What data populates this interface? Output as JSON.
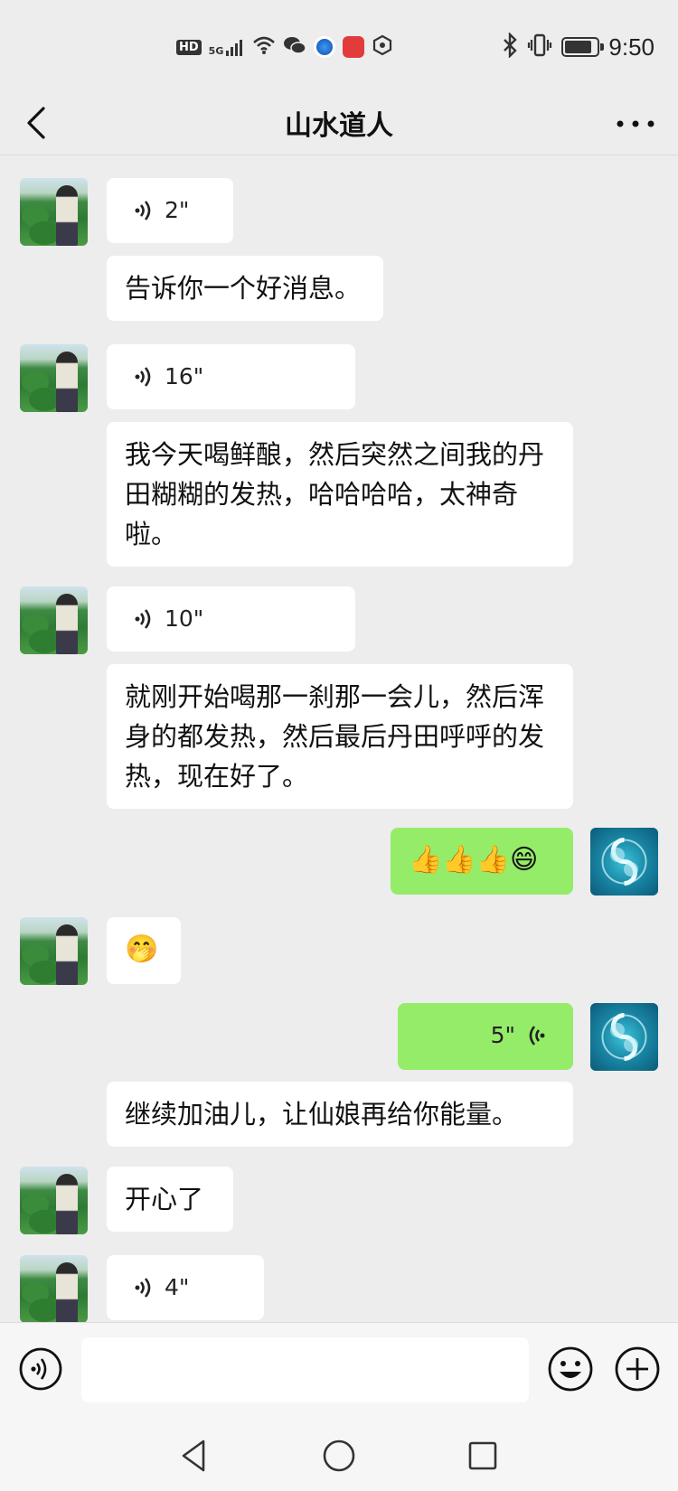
{
  "status_bar": {
    "network_badge": "HD",
    "network_type": "5G",
    "time": "9:50",
    "battery_level": 0.85,
    "icons": [
      "hd-icon",
      "signal-5g-icon",
      "wifi-icon",
      "wechat-icon",
      "browser-app-icon",
      "reader-app-icon",
      "shield-app-icon",
      "bluetooth-icon",
      "vibrate-icon",
      "battery-icon"
    ]
  },
  "header": {
    "title": "山水道人",
    "back_icon": "chevron-left-icon",
    "more_icon": "more-dots-icon"
  },
  "messages": [
    {
      "side": "left",
      "kind": "voice",
      "duration": "2\""
    },
    {
      "side": "left",
      "kind": "text",
      "text": "告诉你一个好消息。"
    },
    {
      "side": "left",
      "kind": "voice",
      "duration": "16\""
    },
    {
      "side": "left",
      "kind": "text",
      "text": "我今天喝鲜酿，然后突然之间我的丹田糊糊的发热，哈哈哈哈，太神奇啦。"
    },
    {
      "side": "left",
      "kind": "voice",
      "duration": "10\""
    },
    {
      "side": "left",
      "kind": "text",
      "text": "就刚开始喝那一刹那一会儿，然后浑身的都发热，然后最后丹田呼呼的发热，现在好了。"
    },
    {
      "side": "right",
      "kind": "emoji",
      "text": "👍👍👍😄"
    },
    {
      "side": "left",
      "kind": "emoji",
      "text": "🤭"
    },
    {
      "side": "right",
      "kind": "voice",
      "duration": "5\""
    },
    {
      "side": "left",
      "kind": "text",
      "text": "继续加油儿，让仙娘再给你能量。"
    },
    {
      "side": "left",
      "kind": "text",
      "text": "开心了"
    },
    {
      "side": "left",
      "kind": "voice",
      "duration": "4\""
    }
  ],
  "input_bar": {
    "voice_icon": "voice-mode-icon",
    "input_value": "",
    "emoji_icon": "emoji-icon",
    "plus_icon": "plus-icon"
  },
  "nav_bar": {
    "icons": [
      "nav-back-icon",
      "nav-home-icon",
      "nav-recent-icon"
    ]
  },
  "colors": {
    "background": "#ededed",
    "bubble_left": "#ffffff",
    "bubble_right": "#95ec69"
  }
}
